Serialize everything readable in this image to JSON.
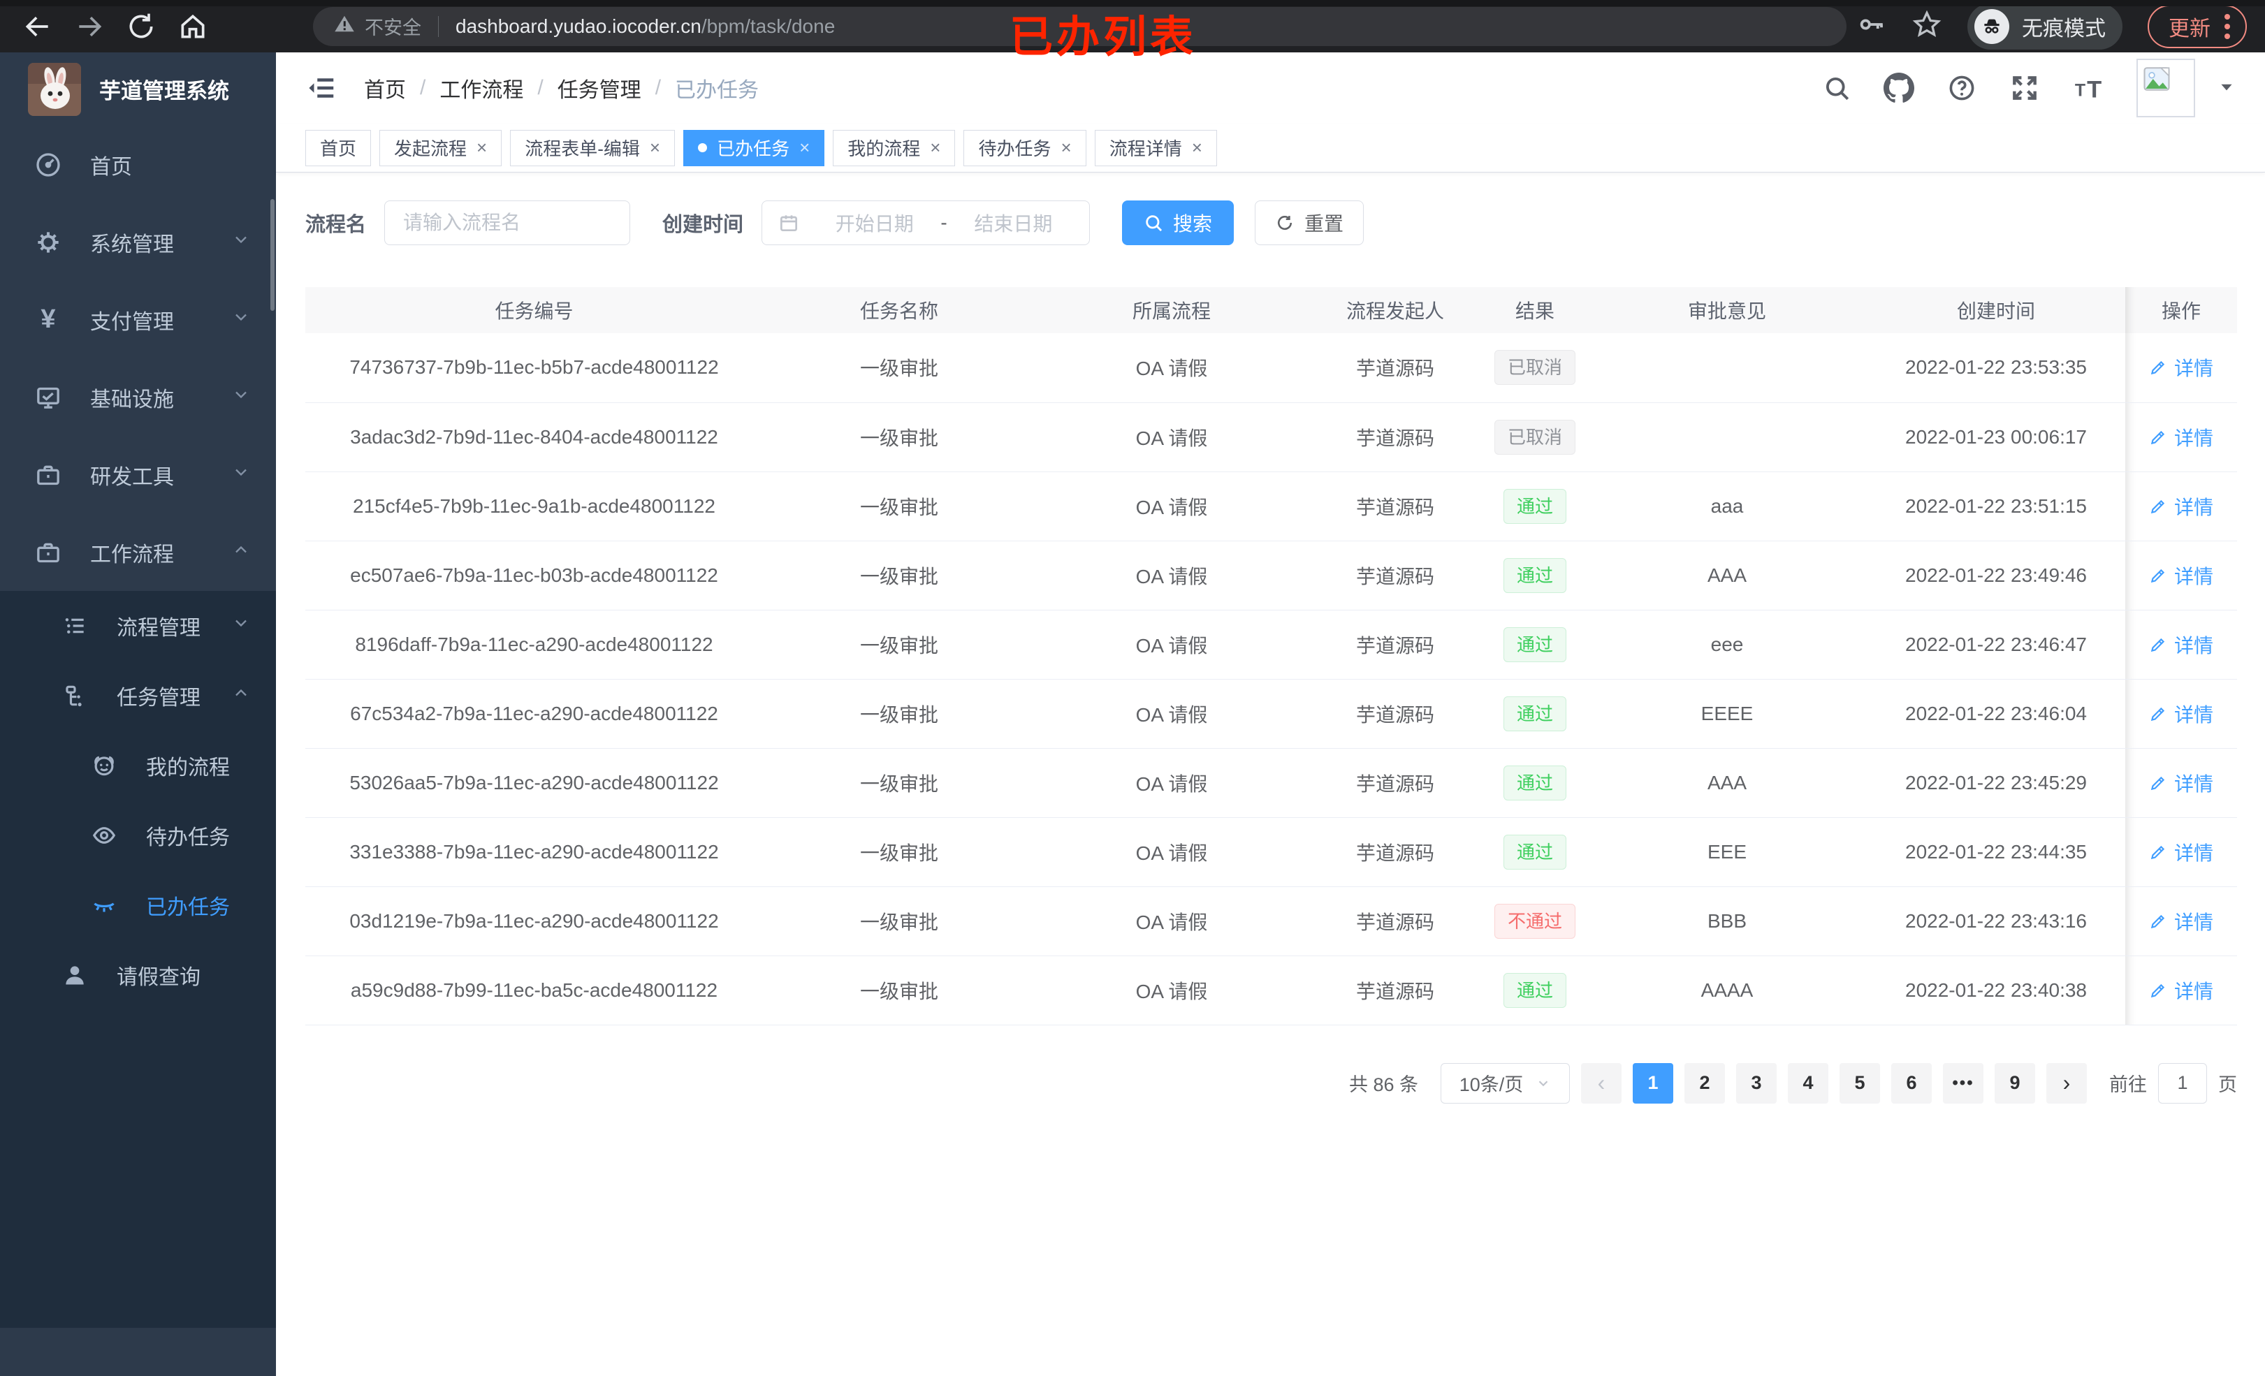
{
  "browser": {
    "security_label": "不安全",
    "url_host": "dashboard.yudao.iocoder.cn",
    "url_path": "/bpm/task/done",
    "incognito_label": "无痕模式",
    "update_label": "更新"
  },
  "annotation": "已办列表",
  "sidebar": {
    "title": "芋道管理系统",
    "items": [
      {
        "label": "首页"
      },
      {
        "label": "系统管理"
      },
      {
        "label": "支付管理"
      },
      {
        "label": "基础设施"
      },
      {
        "label": "研发工具"
      },
      {
        "label": "工作流程"
      },
      {
        "label": "流程管理"
      },
      {
        "label": "任务管理"
      },
      {
        "label": "我的流程"
      },
      {
        "label": "待办任务"
      },
      {
        "label": "已办任务"
      },
      {
        "label": "请假查询"
      }
    ]
  },
  "breadcrumb": [
    "首页",
    "工作流程",
    "任务管理",
    "已办任务"
  ],
  "tabs": [
    {
      "label": "首页"
    },
    {
      "label": "发起流程"
    },
    {
      "label": "流程表单-编辑"
    },
    {
      "label": "已办任务"
    },
    {
      "label": "我的流程"
    },
    {
      "label": "待办任务"
    },
    {
      "label": "流程详情"
    }
  ],
  "filters": {
    "name_label": "流程名",
    "name_placeholder": "请输入流程名",
    "time_label": "创建时间",
    "start_placeholder": "开始日期",
    "range_separator": "-",
    "end_placeholder": "结束日期",
    "search_label": "搜索",
    "reset_label": "重置"
  },
  "table": {
    "columns": [
      "任务编号",
      "任务名称",
      "所属流程",
      "流程发起人",
      "结果",
      "审批意见",
      "创建时间",
      "操作"
    ],
    "action_label": "详情",
    "rows": [
      {
        "id": "74736737-7b9b-11ec-b5b7-acde48001122",
        "name": "一级审批",
        "flow": "OA 请假",
        "starter": "芋道源码",
        "result": "已取消",
        "opinion": "",
        "time": "2022-01-22 23:53:35"
      },
      {
        "id": "3adac3d2-7b9d-11ec-8404-acde48001122",
        "name": "一级审批",
        "flow": "OA 请假",
        "starter": "芋道源码",
        "result": "已取消",
        "opinion": "",
        "time": "2022-01-23 00:06:17"
      },
      {
        "id": "215cf4e5-7b9b-11ec-9a1b-acde48001122",
        "name": "一级审批",
        "flow": "OA 请假",
        "starter": "芋道源码",
        "result": "通过",
        "opinion": "aaa",
        "time": "2022-01-22 23:51:15"
      },
      {
        "id": "ec507ae6-7b9a-11ec-b03b-acde48001122",
        "name": "一级审批",
        "flow": "OA 请假",
        "starter": "芋道源码",
        "result": "通过",
        "opinion": "AAA",
        "time": "2022-01-22 23:49:46"
      },
      {
        "id": "8196daff-7b9a-11ec-a290-acde48001122",
        "name": "一级审批",
        "flow": "OA 请假",
        "starter": "芋道源码",
        "result": "通过",
        "opinion": "eee",
        "time": "2022-01-22 23:46:47"
      },
      {
        "id": "67c534a2-7b9a-11ec-a290-acde48001122",
        "name": "一级审批",
        "flow": "OA 请假",
        "starter": "芋道源码",
        "result": "通过",
        "opinion": "EEEE",
        "time": "2022-01-22 23:46:04"
      },
      {
        "id": "53026aa5-7b9a-11ec-a290-acde48001122",
        "name": "一级审批",
        "flow": "OA 请假",
        "starter": "芋道源码",
        "result": "通过",
        "opinion": "AAA",
        "time": "2022-01-22 23:45:29"
      },
      {
        "id": "331e3388-7b9a-11ec-a290-acde48001122",
        "name": "一级审批",
        "flow": "OA 请假",
        "starter": "芋道源码",
        "result": "通过",
        "opinion": "EEE",
        "time": "2022-01-22 23:44:35"
      },
      {
        "id": "03d1219e-7b9a-11ec-a290-acde48001122",
        "name": "一级审批",
        "flow": "OA 请假",
        "starter": "芋道源码",
        "result": "不通过",
        "opinion": "BBB",
        "time": "2022-01-22 23:43:16"
      },
      {
        "id": "a59c9d88-7b99-11ec-ba5c-acde48001122",
        "name": "一级审批",
        "flow": "OA 请假",
        "starter": "芋道源码",
        "result": "通过",
        "opinion": "AAAA",
        "time": "2022-01-22 23:40:38"
      }
    ]
  },
  "pagination": {
    "total_text": "共 86 条",
    "page_size": "10条/页",
    "prev": "‹",
    "pages": [
      "1",
      "2",
      "3",
      "4",
      "5",
      "6"
    ],
    "ellipsis": "•••",
    "last_page": "9",
    "next": "›",
    "goto_label": "前往",
    "goto_value": "1",
    "goto_suffix": "页"
  },
  "colors": {
    "primary": "#409eff",
    "success": "#3ecf5e",
    "danger": "#f56c6c",
    "sidebar_bg": "#2d3a4b",
    "submenu_bg": "#1f2d3d",
    "chrome_bg": "#202124",
    "annotation_red": "#fe2400"
  }
}
